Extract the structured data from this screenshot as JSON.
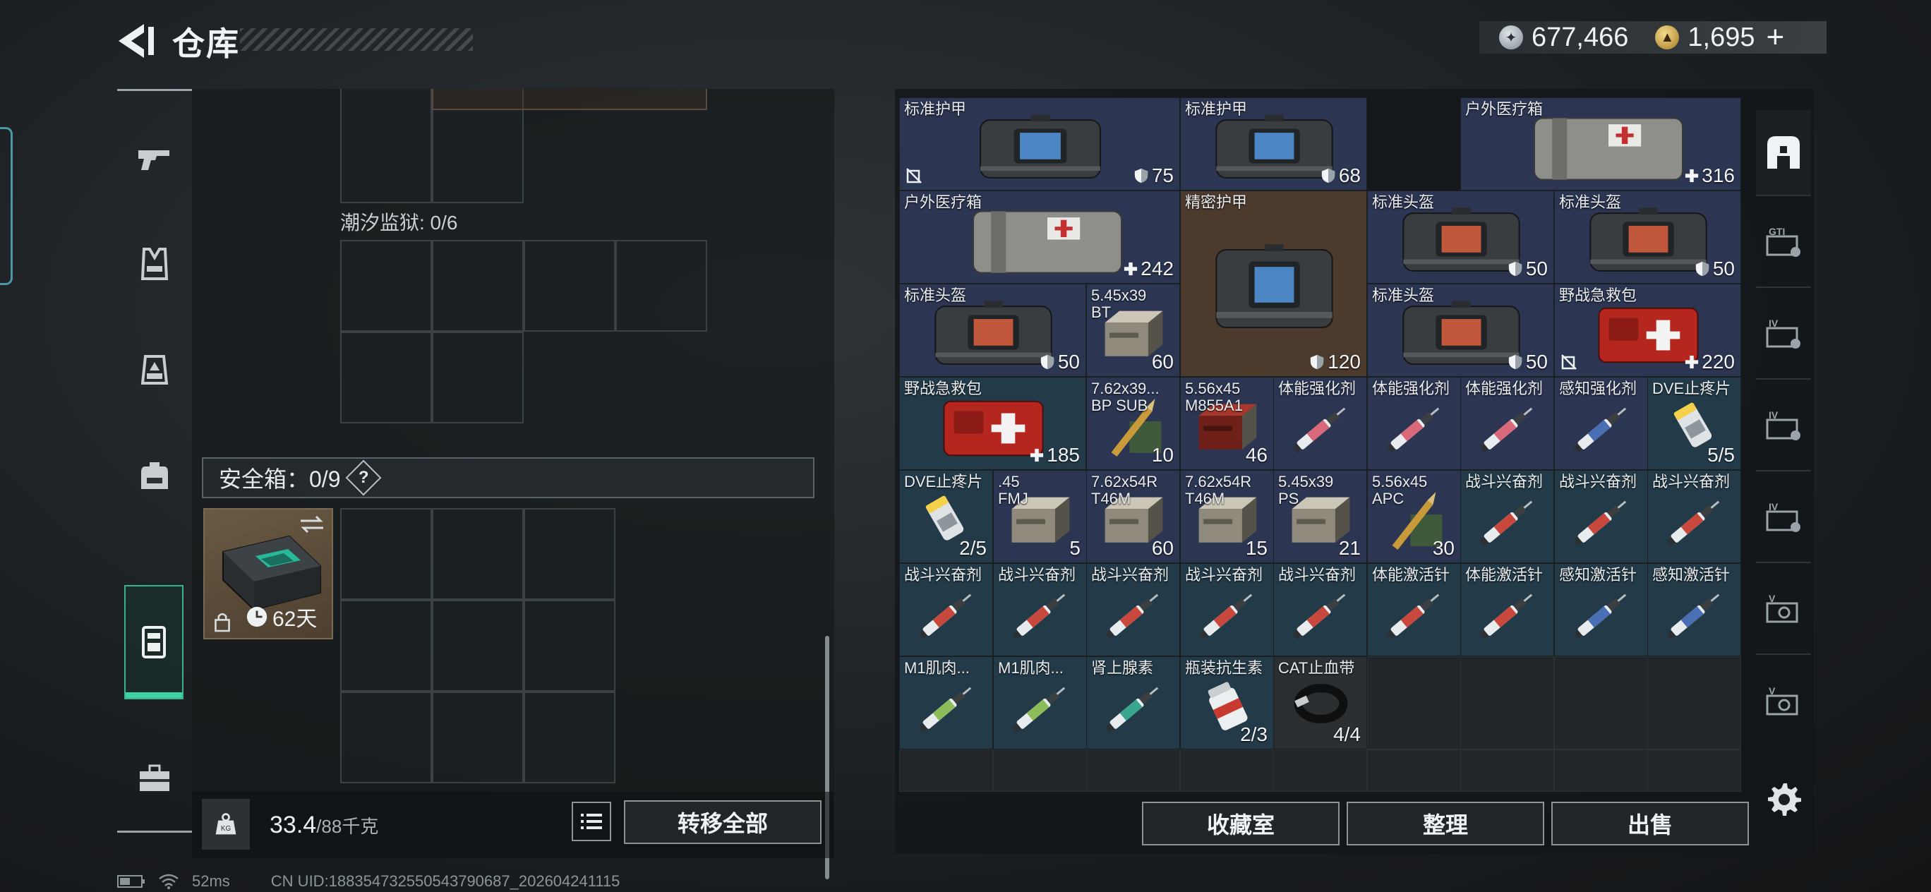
{
  "header": {
    "title": "仓库",
    "currency": [
      {
        "icon": "silver-coin-icon",
        "value": "677,466"
      },
      {
        "icon": "gold-coin-icon",
        "value": "1,695"
      }
    ],
    "add_label": "+"
  },
  "left_nav": [
    {
      "name": "weapon",
      "icon": "pistol-icon"
    },
    {
      "name": "armor",
      "icon": "vest-icon"
    },
    {
      "name": "chest-rig",
      "icon": "chest-rig-icon"
    },
    {
      "name": "backpack",
      "icon": "backpack-icon"
    },
    {
      "name": "safebox",
      "icon": "safebox-icon",
      "active": true
    },
    {
      "name": "toolbox",
      "icon": "toolbox-icon"
    }
  ],
  "left_panel": {
    "prison_label": "潮汐监狱: 0/6",
    "safebox_label": "安全箱：0/9",
    "help_label": "?",
    "safebox_timer": "62天",
    "weight_value": "33.4",
    "weight_cap": "/88千克",
    "transfer_all": "转移全部"
  },
  "inventory": {
    "accent_colors": {
      "blue": "#2c3552",
      "brown": "#4c3a2d",
      "teal": "#233a48"
    },
    "items": [
      {
        "name": "标准护甲",
        "count": "75",
        "stat": "armor",
        "nodur": true,
        "art": "bag-blue",
        "color": "blue"
      },
      {
        "name": "标准护甲",
        "count": "68",
        "stat": "armor",
        "art": "bag-blue",
        "color": "blue"
      },
      {
        "name": "户外医疗箱",
        "count": "316",
        "stat": "heal",
        "art": "medkit-gray",
        "color": "blue"
      },
      {
        "name": "户外医疗箱",
        "count": "242",
        "stat": "heal",
        "art": "medkit-gray",
        "color": "blue"
      },
      {
        "name": "精密护甲",
        "count": "120",
        "stat": "armor",
        "art": "bag-blue",
        "color": "brown"
      },
      {
        "name": "标准头盔",
        "count": "50",
        "stat": "armor",
        "art": "bag-red",
        "color": "blue"
      },
      {
        "name": "标准头盔",
        "count": "50",
        "stat": "armor",
        "art": "bag-red",
        "color": "blue"
      },
      {
        "name": "标准头盔",
        "count": "50",
        "stat": "armor",
        "art": "bag-red",
        "color": "blue"
      },
      {
        "name": "5.45x39\nBT",
        "count": "60",
        "art": "ammo-box",
        "color": "blue"
      },
      {
        "name": "标准头盔",
        "count": "50",
        "stat": "armor",
        "art": "bag-red",
        "color": "blue"
      },
      {
        "name": "野战急救包",
        "count": "220",
        "stat": "heal",
        "nodur": true,
        "art": "firstaid",
        "color": "blue"
      },
      {
        "name": "野战急救包",
        "count": "185",
        "stat": "heal",
        "art": "firstaid",
        "color": "teal"
      },
      {
        "name": "7.62x39...\nBP SUB",
        "count": "10",
        "art": "ammo-bullet",
        "color": "blue"
      },
      {
        "name": "5.56x45\nM855A1",
        "count": "46",
        "art": "ammo-red",
        "color": "blue"
      },
      {
        "name": "体能强化剂",
        "count": "",
        "art": "inj-pink",
        "color": "blue"
      },
      {
        "name": "体能强化剂",
        "count": "",
        "art": "inj-pink",
        "color": "blue"
      },
      {
        "name": "体能强化剂",
        "count": "",
        "art": "inj-pink",
        "color": "blue"
      },
      {
        "name": "感知强化剂",
        "count": "",
        "art": "inj-blue",
        "color": "blue"
      },
      {
        "name": "DVE止疼片",
        "count": "5/5",
        "art": "pills",
        "color": "teal"
      },
      {
        "name": "DVE止疼片",
        "count": "2/5",
        "art": "pills",
        "color": "teal"
      },
      {
        "name": ".45\nFMJ",
        "count": "5",
        "art": "ammo-box",
        "color": "blue"
      },
      {
        "name": "7.62x54R\nT46M",
        "count": "60",
        "art": "ammo-box",
        "color": "blue"
      },
      {
        "name": "7.62x54R\nT46M",
        "count": "15",
        "art": "ammo-box",
        "color": "blue"
      },
      {
        "name": "5.45x39\nPS",
        "count": "21",
        "art": "ammo-box",
        "color": "blue"
      },
      {
        "name": "5.56x45\nAPC",
        "count": "30",
        "art": "ammo-bullet",
        "color": "blue"
      },
      {
        "name": "战斗兴奋剂",
        "count": "",
        "art": "inj-red",
        "color": "teal"
      },
      {
        "name": "战斗兴奋剂",
        "count": "",
        "art": "inj-red",
        "color": "teal"
      },
      {
        "name": "战斗兴奋剂",
        "count": "",
        "art": "inj-red",
        "color": "teal"
      },
      {
        "name": "战斗兴奋剂",
        "count": "",
        "art": "inj-red",
        "color": "teal"
      },
      {
        "name": "战斗兴奋剂",
        "count": "",
        "art": "inj-red",
        "color": "teal"
      },
      {
        "name": "战斗兴奋剂",
        "count": "",
        "art": "inj-red",
        "color": "teal"
      },
      {
        "name": "战斗兴奋剂",
        "count": "",
        "art": "inj-red",
        "color": "teal"
      },
      {
        "name": "战斗兴奋剂",
        "count": "",
        "art": "inj-red",
        "color": "teal"
      },
      {
        "name": "体能激活针",
        "count": "",
        "art": "inj-red",
        "color": "teal"
      },
      {
        "name": "体能激活针",
        "count": "",
        "art": "inj-red",
        "color": "teal"
      },
      {
        "name": "感知激活针",
        "count": "",
        "art": "inj-blue",
        "color": "teal"
      },
      {
        "name": "感知激活针",
        "count": "",
        "art": "inj-blue",
        "color": "teal"
      },
      {
        "name": "M1肌肉...",
        "count": "",
        "art": "inj-green",
        "color": "teal"
      },
      {
        "name": "M1肌肉...",
        "count": "",
        "art": "inj-green",
        "color": "teal"
      },
      {
        "name": "肾上腺素",
        "count": "",
        "art": "inj-teal",
        "color": "teal"
      },
      {
        "name": "瓶装抗生素",
        "count": "2/3",
        "art": "bottle",
        "color": "teal"
      },
      {
        "name": "CAT止血带",
        "count": "4/4",
        "art": "tourniquet",
        "color": "dark"
      }
    ]
  },
  "right_sidebar": [
    {
      "name": "all",
      "icon": "stash-icon",
      "active": true
    },
    {
      "name": "gti",
      "icon": "gti-card-icon",
      "label": "GTI"
    },
    {
      "name": "iv-1",
      "icon": "iv-card-icon",
      "label": "IV"
    },
    {
      "name": "iv-2",
      "icon": "iv-card-icon",
      "label": "IV"
    },
    {
      "name": "iv-3",
      "icon": "iv-card-icon",
      "label": "IV"
    },
    {
      "name": "v-1",
      "icon": "v-card-icon",
      "label": "V"
    },
    {
      "name": "v-2",
      "icon": "v-card-icon",
      "label": "V"
    }
  ],
  "footer_buttons": {
    "collection": "收藏室",
    "organize": "整理",
    "sell": "出售"
  },
  "status": {
    "ping": "52ms",
    "uid": "CN UID:188354732550543790687_202604241115"
  }
}
